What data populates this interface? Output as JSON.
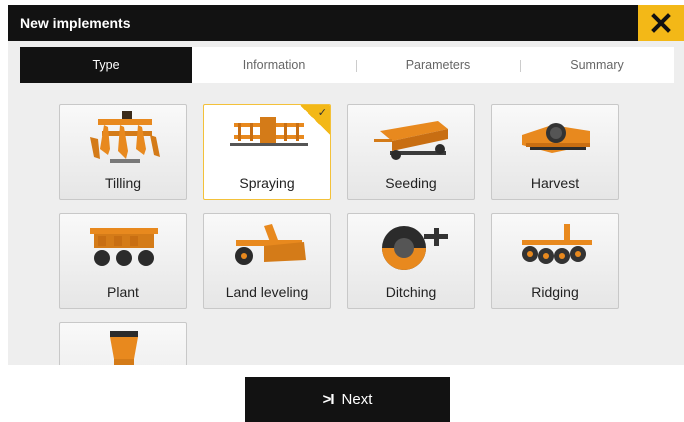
{
  "dialog": {
    "title": "New implements",
    "close_icon": "close-icon"
  },
  "tabs": [
    {
      "label": "Type",
      "active": true
    },
    {
      "label": "Information",
      "active": false
    },
    {
      "label": "Parameters",
      "active": false
    },
    {
      "label": "Summary",
      "active": false
    }
  ],
  "implements": [
    {
      "label": "Tilling",
      "icon": "tilling-implement-image",
      "selected": false
    },
    {
      "label": "Spraying",
      "icon": "spraying-implement-image",
      "selected": true
    },
    {
      "label": "Seeding",
      "icon": "seeding-implement-image",
      "selected": false
    },
    {
      "label": "Harvest",
      "icon": "harvest-implement-image",
      "selected": false
    },
    {
      "label": "Plant",
      "icon": "plant-implement-image",
      "selected": false
    },
    {
      "label": "Land leveling",
      "icon": "land-leveling-implement-image",
      "selected": false
    },
    {
      "label": "Ditching",
      "icon": "ditching-implement-image",
      "selected": false
    },
    {
      "label": "Ridging",
      "icon": "ridging-implement-image",
      "selected": false
    },
    {
      "label": "",
      "icon": "implement-image",
      "selected": false
    }
  ],
  "footer": {
    "next_label": "Next",
    "next_icon": "skip-next-icon"
  },
  "colors": {
    "accent": "#f3b817",
    "dark": "#121212",
    "background": "#eeeeee",
    "implement": "#e8891e"
  }
}
